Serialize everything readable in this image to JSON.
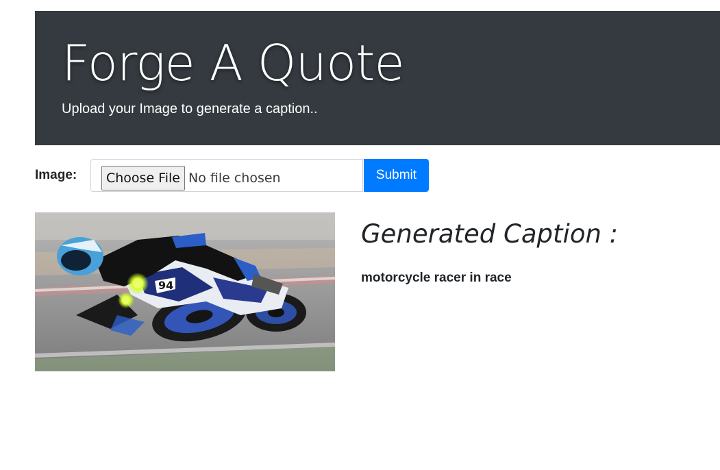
{
  "header": {
    "title": "Forge A Quote",
    "subtitle": "Upload your Image to generate a caption.."
  },
  "upload_form": {
    "image_label": "Image:",
    "choose_file_label": "Choose File",
    "file_status": "No file chosen",
    "submit_label": "Submit"
  },
  "result": {
    "image_description": "motorcycle racer leaning into a turn on a race track",
    "caption_heading": "Generated Caption :",
    "caption_text": "motorcycle racer in race"
  },
  "colors": {
    "header_bg": "#343a40",
    "header_text": "#ffffff",
    "submit_bg": "#007bff",
    "submit_text": "#ffffff",
    "body_text": "#212529"
  }
}
